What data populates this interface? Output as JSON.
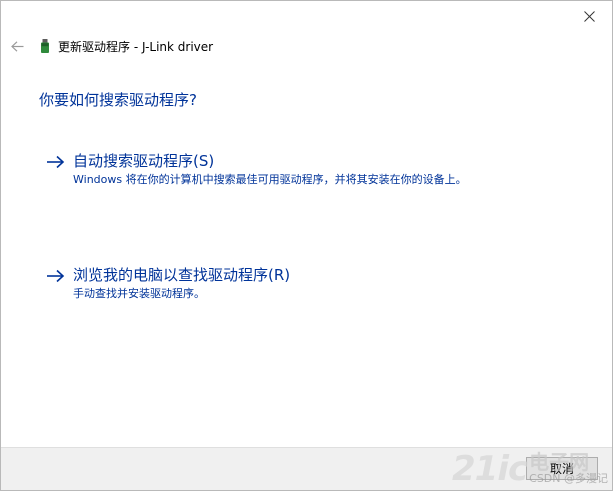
{
  "window": {
    "close_glyph": "✕"
  },
  "header": {
    "back_icon": "back-arrow-icon",
    "device_icon": "usb-device-icon",
    "title": "更新驱动程序 - J-Link driver"
  },
  "question": "你要如何搜索驱动程序?",
  "options": [
    {
      "icon": "right-arrow-icon",
      "title": "自动搜索驱动程序(S)",
      "description": "Windows 将在你的计算机中搜索最佳可用驱动程序，并将其安装在你的设备上。"
    },
    {
      "icon": "right-arrow-icon",
      "title": "浏览我的电脑以查找驱动程序(R)",
      "description": "手动查找并安装驱动程序。"
    }
  ],
  "footer": {
    "cancel_label": "取消"
  },
  "watermark": {
    "logo": "21ic",
    "cn": "电子网",
    "csdn": "CSDN @多漫记"
  },
  "colors": {
    "link": "#003399",
    "footer_bg": "#f0f0f0"
  }
}
